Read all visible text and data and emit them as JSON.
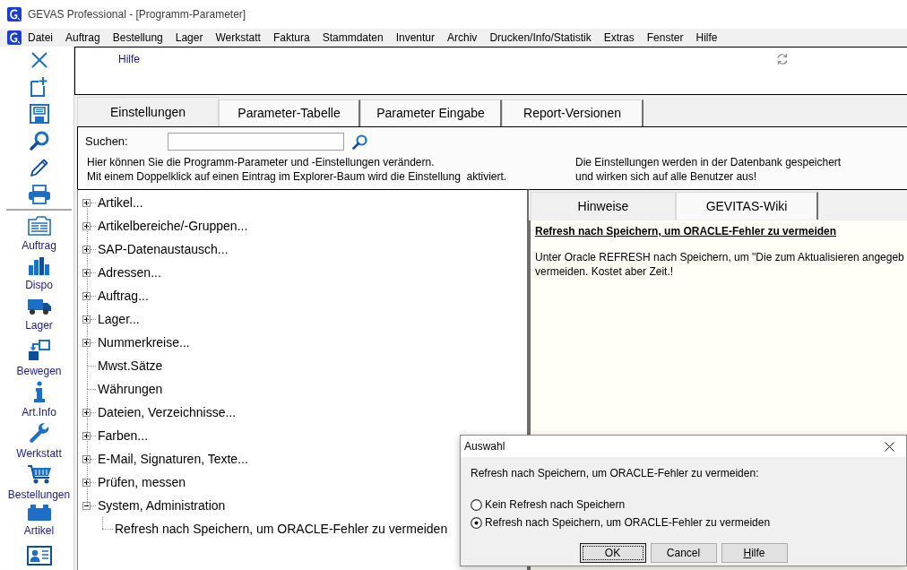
{
  "window": {
    "title": "GEVAS Professional - [Programm-Parameter]"
  },
  "menu": [
    "Datei",
    "Auftrag",
    "Bestellung",
    "Lager",
    "Werkstatt",
    "Faktura",
    "Stammdaten",
    "Inventur",
    "Archiv",
    "Drucken/Info/Statistik",
    "Extras",
    "Fenster",
    "Hilfe"
  ],
  "toolbar": {
    "items": [
      "Auftrag",
      "Dispo",
      "Lager",
      "Bewegen",
      "Art.Info",
      "Werkstatt",
      "Bestellungen",
      "Artikel"
    ]
  },
  "header_panel": {
    "link": "Hilfe"
  },
  "tabs": [
    {
      "label": "Einstellungen",
      "selected": true
    },
    {
      "label": "Parameter-Tabelle",
      "selected": false
    },
    {
      "label": "Parameter Eingabe",
      "selected": false
    },
    {
      "label": "Report-Versionen",
      "selected": false
    }
  ],
  "search": {
    "label": "Suchen:"
  },
  "notes": {
    "left": [
      "Hier können Sie die Programm-Parameter und -Einstellungen verändern.",
      "Mit einem Doppelklick auf einen Eintrag im Explorer-Baum wird die Einstellung  aktiviert."
    ],
    "right": [
      "Die Einstellungen werden in der Datenbank gespeichert",
      "und wirken sich auf alle Benutzer aus!"
    ]
  },
  "tree": {
    "items": [
      {
        "label": "Artikel...",
        "kind": "group",
        "expanded": false
      },
      {
        "label": "Artikelbereiche/-Gruppen...",
        "kind": "group",
        "expanded": false
      },
      {
        "label": "SAP-Datenaustausch...",
        "kind": "group",
        "expanded": false
      },
      {
        "label": "Adressen...",
        "kind": "group",
        "expanded": false
      },
      {
        "label": "Auftrag...",
        "kind": "group",
        "expanded": false
      },
      {
        "label": "Lager...",
        "kind": "group",
        "expanded": false
      },
      {
        "label": "Nummerkreise...",
        "kind": "group",
        "expanded": false
      },
      {
        "label": "Mwst.Sätze",
        "kind": "leaf"
      },
      {
        "label": "Währungen",
        "kind": "leaf"
      },
      {
        "label": "Dateien, Verzeichnisse...",
        "kind": "group",
        "expanded": false
      },
      {
        "label": "Farben...",
        "kind": "group",
        "expanded": false
      },
      {
        "label": "E-Mail, Signaturen, Texte...",
        "kind": "group",
        "expanded": false
      },
      {
        "label": "Prüfen, messen",
        "kind": "group",
        "expanded": false
      },
      {
        "label": "System, Administration",
        "kind": "group",
        "expanded": true,
        "children": [
          {
            "label": "Refresh nach Speichern, um ORACLE-Fehler zu vermeiden",
            "kind": "leaf"
          }
        ]
      }
    ]
  },
  "info_panel": {
    "tabs": [
      {
        "label": "Hinweise",
        "selected": true
      },
      {
        "label": "GEVITAS-Wiki",
        "selected": false
      }
    ],
    "heading": "Refresh nach Speichern, um ORACLE-Fehler zu vermeiden",
    "lines": [
      "Unter Oracle REFRESH nach Speichern, um \"Die zum Aktualisieren angegeb",
      "vermeiden. Kostet aber Zeit.!"
    ]
  },
  "dialog": {
    "title": "Auswahl",
    "prompt": "Refresh nach Speichern, um ORACLE-Fehler zu vermeiden:",
    "options": [
      {
        "label": "Kein Refresh nach Speichern",
        "selected": false
      },
      {
        "label": "Refresh nach Speichern, um ORACLE-Fehler zu vermeiden",
        "selected": true
      }
    ],
    "buttons": [
      {
        "label": "OK",
        "focused": true,
        "mnemonic": false
      },
      {
        "label": "Cancel",
        "focused": false,
        "mnemonic": false
      },
      {
        "label": "Hilfe",
        "focused": false,
        "mnemonic": true
      }
    ]
  }
}
